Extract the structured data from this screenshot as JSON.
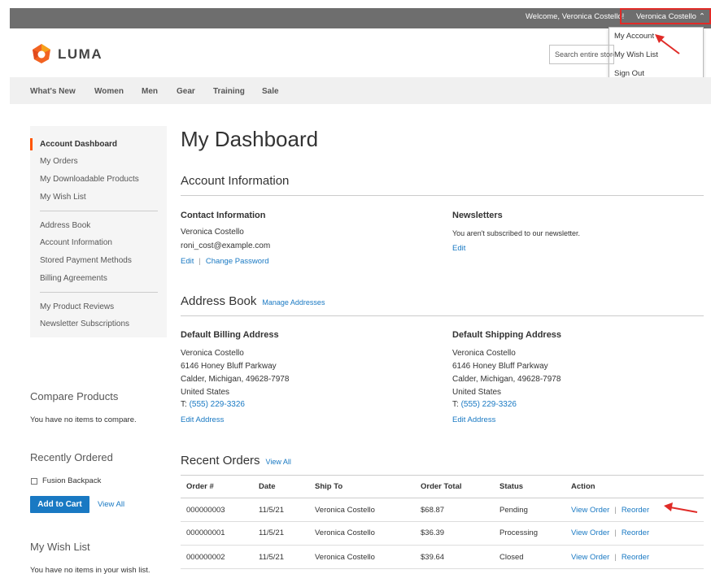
{
  "header": {
    "welcome": "Welcome, Veronica Costello!",
    "account_toggle": "Veronica Costello",
    "account_menu": [
      "My Account",
      "My Wish List",
      "Sign Out"
    ],
    "logo_text": "LUMA",
    "search_placeholder": "Search entire store here..."
  },
  "nav": [
    "What's New",
    "Women",
    "Men",
    "Gear",
    "Training",
    "Sale"
  ],
  "sidebar": {
    "items": [
      "Account Dashboard",
      "My Orders",
      "My Downloadable Products",
      "My Wish List",
      "Address Book",
      "Account Information",
      "Stored Payment Methods",
      "Billing Agreements",
      "My Product Reviews",
      "Newsletter Subscriptions"
    ],
    "compare_title": "Compare Products",
    "compare_text": "You have no items to compare.",
    "recent_title": "Recently Ordered",
    "recent_item": "Fusion Backpack",
    "add_to_cart": "Add to Cart",
    "view_all": "View All",
    "wishlist_title": "My Wish List",
    "wishlist_text": "You have no items in your wish list."
  },
  "main": {
    "title": "My Dashboard",
    "account_info_title": "Account Information",
    "contact": {
      "title": "Contact Information",
      "name": "Veronica Costello",
      "email": "roni_cost@example.com",
      "edit": "Edit",
      "change_password": "Change Password"
    },
    "newsletters": {
      "title": "Newsletters",
      "text": "You aren't subscribed to our newsletter.",
      "edit": "Edit"
    },
    "address_book_title": "Address Book",
    "manage_addresses": "Manage Addresses",
    "billing": {
      "title": "Default Billing Address",
      "lines": [
        "Veronica Costello",
        "6146 Honey Bluff Parkway",
        "Calder, Michigan, 49628-7978",
        "United States"
      ],
      "phone_prefix": "T: ",
      "phone": "(555) 229-3326",
      "edit": "Edit Address"
    },
    "shipping": {
      "title": "Default Shipping Address",
      "lines": [
        "Veronica Costello",
        "6146 Honey Bluff Parkway",
        "Calder, Michigan, 49628-7978",
        "United States"
      ],
      "phone_prefix": "T: ",
      "phone": "(555) 229-3326",
      "edit": "Edit Address"
    },
    "recent_orders_title": "Recent Orders",
    "view_all": "View All",
    "orders": {
      "columns": [
        "Order #",
        "Date",
        "Ship To",
        "Order Total",
        "Status",
        "Action"
      ],
      "rows": [
        {
          "id": "000000003",
          "date": "11/5/21",
          "ship_to": "Veronica Costello",
          "total": "$68.87",
          "status": "Pending",
          "view": "View Order",
          "reorder": "Reorder"
        },
        {
          "id": "000000001",
          "date": "11/5/21",
          "ship_to": "Veronica Costello",
          "total": "$36.39",
          "status": "Processing",
          "view": "View Order",
          "reorder": "Reorder"
        },
        {
          "id": "000000002",
          "date": "11/5/21",
          "ship_to": "Veronica Costello",
          "total": "$39.64",
          "status": "Closed",
          "view": "View Order",
          "reorder": "Reorder"
        }
      ]
    }
  },
  "colors": {
    "link": "#1979c3",
    "accent": "#ff5501",
    "highlight": "#e02b27",
    "topbar": "#6e6e6e"
  }
}
